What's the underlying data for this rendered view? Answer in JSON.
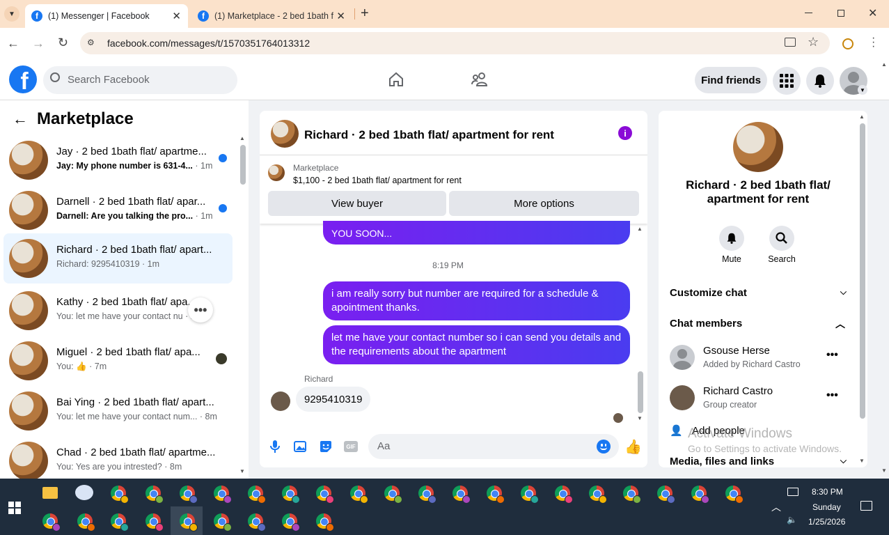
{
  "browser": {
    "tabs": [
      {
        "title": "(1) Messenger | Facebook"
      },
      {
        "title": "(1) Marketplace - 2 bed 1bath f"
      }
    ],
    "url": "facebook.com/messages/t/1570351764013312"
  },
  "fb_header": {
    "search_placeholder": "Search Facebook",
    "find_friends_label": "Find friends"
  },
  "left_panel": {
    "title": "Marketplace",
    "conversations": [
      {
        "name": "Jay · 2 bed 1bath flat/ apartme...",
        "preview": "Jay: My phone number is 631-4...",
        "time": "· 1m",
        "unread": true
      },
      {
        "name": "Darnell · 2 bed 1bath flat/ apar...",
        "preview": "Darnell: Are you talking the pro...",
        "time": "· 1m",
        "unread": true
      },
      {
        "name": "Richard · 2 bed 1bath flat/ apart...",
        "preview": "Richard: 9295410319",
        "time": "· 1m",
        "unread": false,
        "selected": true
      },
      {
        "name": "Kathy · 2 bed 1bath flat/ apa...",
        "preview": "You: let me have your contact nu",
        "time": "· 1m",
        "unread": false
      },
      {
        "name": "Miguel · 2 bed 1bath flat/ apa...",
        "preview": "You:",
        "time": "· 7m",
        "unread": false
      },
      {
        "name": "Bai Ying · 2 bed 1bath flat/ apart...",
        "preview": "You: let me have your contact num...",
        "time": "· 8m",
        "unread": false
      },
      {
        "name": "Chad · 2 bed 1bath flat/ apartme...",
        "preview": "You: Yes are you intrested?",
        "time": "· 8m",
        "unread": false
      }
    ]
  },
  "chat": {
    "title": "Richard · 2 bed 1bath flat/ apartment for rent",
    "listing_label": "Marketplace",
    "listing_price_title": "$1,100 - 2 bed 1bath flat/ apartment for rent",
    "view_buyer_label": "View buyer",
    "more_options_label": "More options",
    "partial_bubble": "YOU SOON...",
    "timestamp": "8:19 PM",
    "messages": [
      {
        "from": "me",
        "text": "i am really sorry but number are required for a schedule & apointment thanks."
      },
      {
        "from": "me",
        "text": "let me have your contact number so i can send you details and the requirements about the apartment"
      }
    ],
    "reply_sender": "Richard",
    "reply_text": "9295410319",
    "composer_placeholder": "Aa"
  },
  "info_panel": {
    "title": "Richard · 2 bed 1bath flat/ apartment for rent",
    "mute_label": "Mute",
    "search_label": "Search",
    "customize_chat_label": "Customize chat",
    "chat_members_label": "Chat members",
    "members": [
      {
        "name": "Gsouse Herse",
        "role": "Added by Richard Castro"
      },
      {
        "name": "Richard Castro",
        "role": "Group creator"
      }
    ],
    "add_people_label": "Add people",
    "media_label": "Media, files and links",
    "watermark_line1": "Activate Windows",
    "watermark_line2": "Go to Settings to activate Windows."
  },
  "taskbar": {
    "time": "8:30 PM",
    "day": "Sunday",
    "date": "1/25/2026"
  },
  "colors": {
    "fb_blue": "#1877f2",
    "bubble_start": "#7a1ff0",
    "bubble_end": "#4a3cf0",
    "tab_bar": "#fbe2cb",
    "taskbar": "#1f2d3d"
  }
}
